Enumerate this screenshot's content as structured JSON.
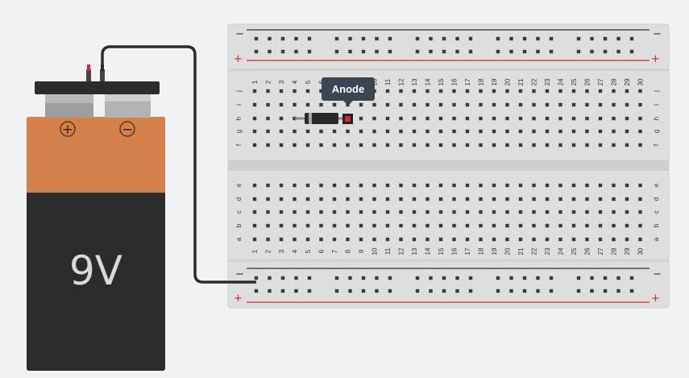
{
  "battery": {
    "voltage_label": "9V",
    "plus_symbol": "+",
    "minus_symbol": "−"
  },
  "breadboard": {
    "rail_plus": "+",
    "rail_minus": "−",
    "columns": [
      "1",
      "2",
      "3",
      "4",
      "5",
      "6",
      "7",
      "8",
      "9",
      "10",
      "11",
      "12",
      "13",
      "14",
      "15",
      "16",
      "17",
      "18",
      "19",
      "20",
      "21",
      "22",
      "23",
      "24",
      "25",
      "26",
      "27",
      "28",
      "29",
      "30"
    ],
    "rows_top": [
      "j",
      "i",
      "h",
      "g",
      "f"
    ],
    "rows_bottom": [
      "e",
      "d",
      "c",
      "b",
      "a"
    ]
  },
  "component": {
    "type": "diode",
    "tooltip": "Anode"
  },
  "colors": {
    "wire": "#2b2b2b",
    "pin_red": "#e8202a",
    "rail_red": "#d7242f",
    "battery_orange": "#d4804a",
    "battery_black": "#2c2c2c",
    "breadboard": "#dedede"
  }
}
